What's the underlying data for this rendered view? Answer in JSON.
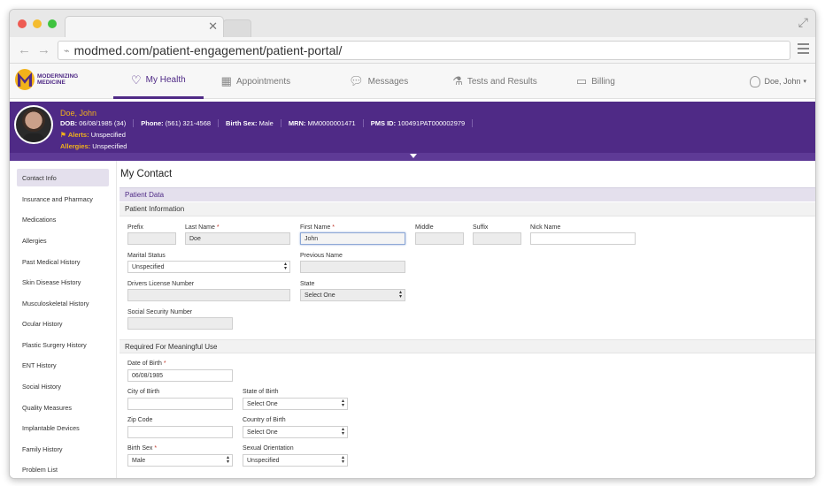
{
  "browser": {
    "url": "modmed.com/patient-engagement/patient-portal/"
  },
  "colors": {
    "brand_purple": "#4f2a86",
    "brand_gold": "#f2b21a",
    "dot_red": "#ee5b52",
    "dot_yellow": "#f4bc2f",
    "dot_green": "#3fc33f"
  },
  "logo": {
    "line1": "MODERNIZING",
    "line2": "MEDICINE"
  },
  "nav": {
    "items": [
      {
        "label": "My Health",
        "icon": "heart-pulse-icon"
      },
      {
        "label": "Appointments",
        "icon": "calendar-icon"
      },
      {
        "label": "Messages",
        "icon": "chat-bubbles-icon"
      },
      {
        "label": "Tests and Results",
        "icon": "microscope-icon"
      },
      {
        "label": "Billing",
        "icon": "credit-card-icon"
      }
    ],
    "user": "Doe, John"
  },
  "patient": {
    "name": "Doe, John",
    "dob_label": "DOB:",
    "dob": "06/08/1985 (34)",
    "phone_label": "Phone:",
    "phone": "(561) 321-4568",
    "sex_label": "Birth Sex:",
    "sex": "Male",
    "mrn_label": "MRN:",
    "mrn": "MM0000001471",
    "pms_label": "PMS ID:",
    "pms": "100491PAT000002979",
    "alerts_label": "Alerts:",
    "alerts": "Unspecified",
    "allergies_label": "Allergies:",
    "allergies": "Unspecified"
  },
  "sidebar": {
    "items": [
      "Contact Info",
      "Insurance and Pharmacy",
      "Medications",
      "Allergies",
      "Past Medical History",
      "Skin Disease History",
      "Musculoskeletal History",
      "Ocular History",
      "Plastic Surgery History",
      "ENT History",
      "Social History",
      "Quality Measures",
      "Implantable Devices",
      "Family History",
      "Problem List"
    ]
  },
  "main": {
    "title": "My Contact",
    "section": "Patient Data",
    "patient_info": {
      "heading": "Patient Information",
      "prefix_label": "Prefix",
      "prefix": "",
      "last_label": "Last Name",
      "last": "Doe",
      "first_label": "First Name",
      "first": "John",
      "middle_label": "Middle",
      "middle": "",
      "suffix_label": "Suffix",
      "suffix": "",
      "nick_label": "Nick Name",
      "nick": "",
      "marital_label": "Marital Status",
      "marital": "Unspecified",
      "prevname_label": "Previous Name",
      "prevname": "",
      "license_label": "Drivers License Number",
      "license": "",
      "state_label": "State",
      "state": "Select One",
      "ssn_label": "Social Security Number",
      "ssn": ""
    },
    "meaningful_use": {
      "heading": "Required For Meaningful Use",
      "dob_label": "Date of Birth",
      "dob": "06/08/1985",
      "city_label": "City of Birth",
      "city": "",
      "stateb_label": "State of Birth",
      "stateb": "Select One",
      "zip_label": "Zip Code",
      "zip": "",
      "country_label": "Country of Birth",
      "country": "Select One",
      "sex_label": "Birth Sex",
      "sex": "Male",
      "orient_label": "Sexual Orientation",
      "orient": "Unspecified"
    },
    "required_mark": "*"
  }
}
